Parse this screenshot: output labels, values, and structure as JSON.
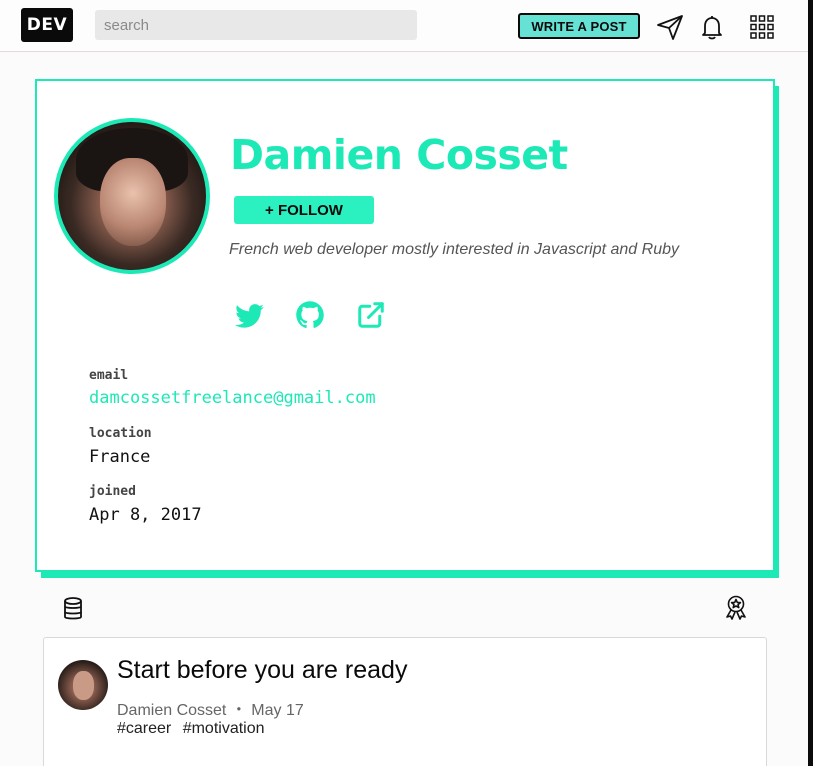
{
  "header": {
    "logo_text": "DEV",
    "search_placeholder": "search",
    "write_post_label": "WRITE A POST",
    "icons": [
      "send-icon",
      "bell-icon",
      "grid-menu-icon"
    ]
  },
  "profile": {
    "name": "Damien Cosset",
    "follow_label": "+ FOLLOW",
    "bio": "French web developer mostly interested in Javascript and Ruby",
    "social_icons": [
      "twitter-icon",
      "github-icon",
      "external-link-icon"
    ],
    "meta": {
      "email_label": "email",
      "email_value": "damcossetfreelance@gmail.com",
      "location_label": "location",
      "location_value": "France",
      "joined_label": "joined",
      "joined_value": "Apr 8, 2017"
    }
  },
  "sub_icons": [
    "database-icon",
    "award-badge-icon"
  ],
  "article": {
    "title": "Start before you are ready",
    "author": "Damien Cosset",
    "separator": "・",
    "date": "May 17",
    "tags": [
      "#career",
      "#motivation"
    ]
  },
  "colors": {
    "accent": "#1de9b6",
    "write_button": "#66e2d5",
    "dark": "#0a0a0a"
  }
}
